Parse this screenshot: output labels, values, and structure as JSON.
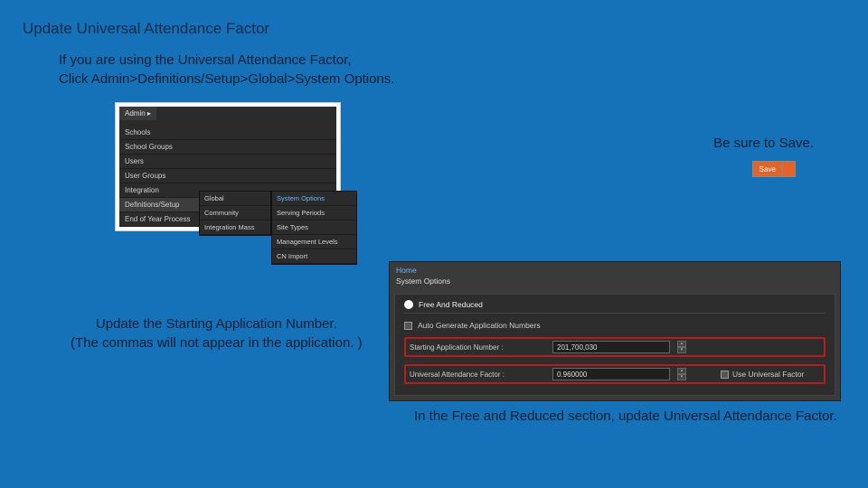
{
  "title": "Update Universal Attendance Factor",
  "intro_line1": "If you are using the Universal Attendance Factor,",
  "intro_line2": "Click Admin>Definitions/Setup>Global>System Options.",
  "save_instruction": "Be sure to Save.",
  "save_button": "Save",
  "menu": {
    "admin": "Admin",
    "col1": [
      "Schools",
      "School Groups",
      "Users",
      "User Groups",
      "Integration",
      "Definitions/Setup",
      "End of Year Process"
    ],
    "col2": [
      "Global",
      "Community",
      "Integration Mass"
    ],
    "col3": [
      "System Options",
      "Serving Periods",
      "Site Types",
      "Management Levels",
      "CN Import"
    ]
  },
  "note1_line1": "Update the Starting Application Number.",
  "note1_line2": "(The commas will not appear in the application. )",
  "panel": {
    "home": "Home",
    "systemopts": "System Options",
    "free_reduced": "Free And Reduced",
    "autogen": "Auto Generate Application Numbers",
    "startnum_label": "Starting Application Number :",
    "startnum_value": "201,700,030",
    "uaf_label": "Universal Attendance Factor :",
    "uaf_value": "0.960000",
    "use_universal": "Use Universal Factor"
  },
  "caption": "In the Free and Reduced section, update Universal Attendance Factor."
}
